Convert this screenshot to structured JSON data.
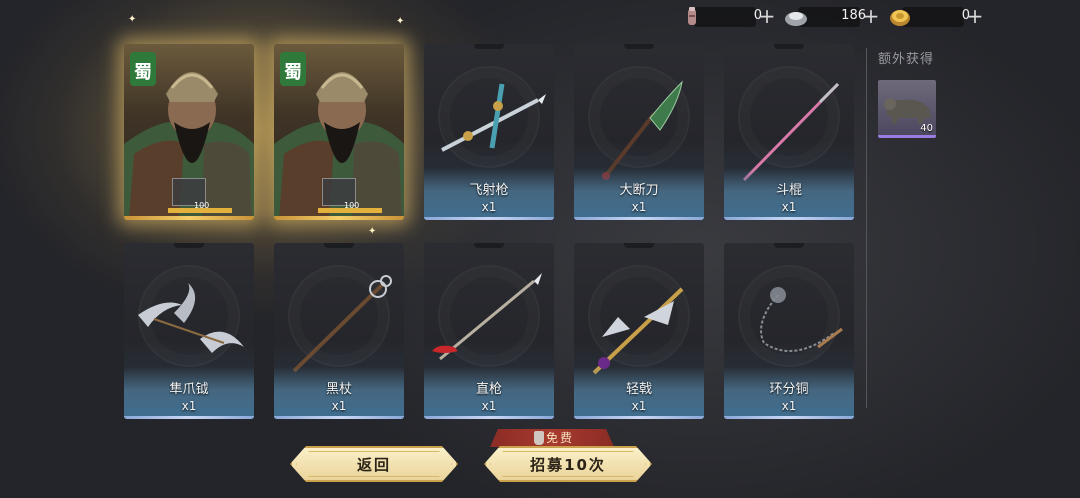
{
  "currencies": [
    {
      "icon": "scroll-token-icon",
      "amount": "0",
      "plus": "+"
    },
    {
      "icon": "silver-ingot-icon",
      "amount": "186",
      "plus": "+"
    },
    {
      "icon": "gold-coin-icon",
      "amount": "0",
      "plus": "+"
    }
  ],
  "heroes": [
    {
      "faction_badge": "蜀",
      "shard_count": "100",
      "progress": 1.0
    },
    {
      "faction_badge": "蜀",
      "shard_count": "100",
      "progress": 1.0
    }
  ],
  "weapons": [
    {
      "name": "飞射枪",
      "qty": "x1"
    },
    {
      "name": "大断刀",
      "qty": "x1"
    },
    {
      "name": "斗棍",
      "qty": "x1"
    },
    {
      "name": "隼爪钺",
      "qty": "x1"
    },
    {
      "name": "黑杖",
      "qty": "x1"
    },
    {
      "name": "直枪",
      "qty": "x1"
    },
    {
      "name": "轻戟",
      "qty": "x1"
    },
    {
      "name": "环分铜",
      "qty": "x1"
    }
  ],
  "extra": {
    "title": "额外获得",
    "item": {
      "icon": "beast-figure-icon",
      "count": "40"
    }
  },
  "buttons": {
    "back_label": "返回",
    "recruit_label": "招募10次",
    "free_tag": "免费"
  },
  "colors": {
    "hero_glow": "#f0c86e",
    "rarity_blue": "#8aa8d8",
    "button_gold": "#ead49a",
    "free_red": "#a83a2e"
  }
}
